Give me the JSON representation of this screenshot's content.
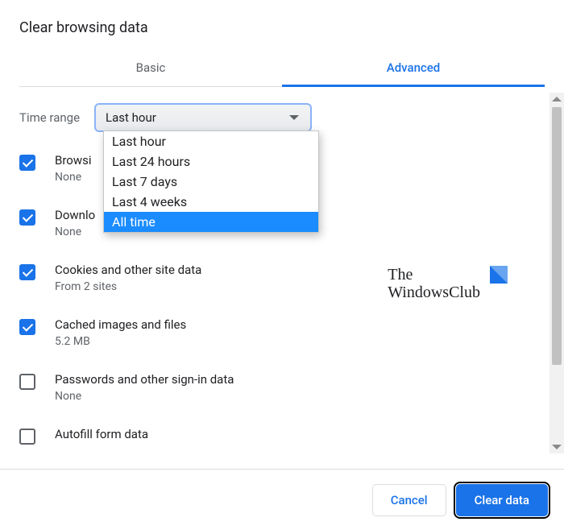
{
  "title": "Clear browsing data",
  "tabs": {
    "basic": "Basic",
    "advanced": "Advanced"
  },
  "time_range": {
    "label": "Time range",
    "selected": "Last hour",
    "options": [
      "Last hour",
      "Last 24 hours",
      "Last 7 days",
      "Last 4 weeks",
      "All time"
    ]
  },
  "items": [
    {
      "title": "Browsi",
      "sub": "None",
      "checked": true
    },
    {
      "title": "Downlo",
      "sub": "None",
      "checked": true
    },
    {
      "title": "Cookies and other site data",
      "sub": "From 2 sites",
      "checked": true
    },
    {
      "title": "Cached images and files",
      "sub": "5.2 MB",
      "checked": true
    },
    {
      "title": "Passwords and other sign-in data",
      "sub": "None",
      "checked": false
    },
    {
      "title": "Autofill form data",
      "sub": "",
      "checked": false
    }
  ],
  "watermark": {
    "line1": "The",
    "line2": "WindowsClub"
  },
  "buttons": {
    "cancel": "Cancel",
    "clear": "Clear data"
  }
}
